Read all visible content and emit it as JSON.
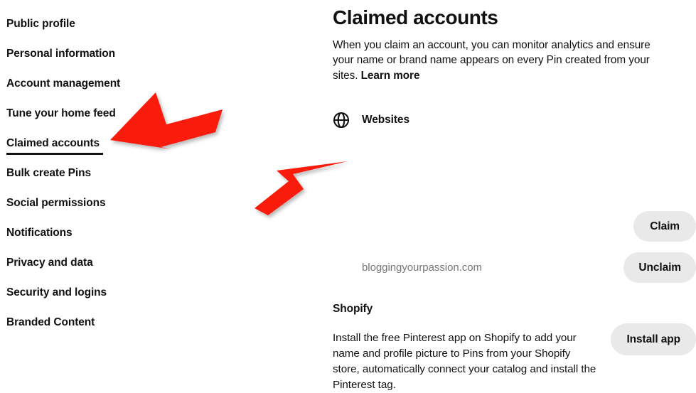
{
  "sidebar": {
    "items": [
      {
        "label": "Public profile",
        "active": false
      },
      {
        "label": "Personal information",
        "active": false
      },
      {
        "label": "Account management",
        "active": false
      },
      {
        "label": "Tune your home feed",
        "active": false
      },
      {
        "label": "Claimed accounts",
        "active": true
      },
      {
        "label": "Bulk create Pins",
        "active": false
      },
      {
        "label": "Social permissions",
        "active": false
      },
      {
        "label": "Notifications",
        "active": false
      },
      {
        "label": "Privacy and data",
        "active": false
      },
      {
        "label": "Security and logins",
        "active": false
      },
      {
        "label": "Branded Content",
        "active": false
      }
    ]
  },
  "main": {
    "title": "Claimed accounts",
    "description": "When you claim an account, you can monitor analytics and ensure your name or brand name appears on every Pin created from your sites. ",
    "learn_more_label": "Learn more",
    "websites": {
      "icon": "globe-icon",
      "label": "Websites",
      "claim_button_label": "Claim",
      "claimed_domain": "bloggingyourpassion.com",
      "unclaim_button_label": "Unclaim"
    },
    "shopify": {
      "title": "Shopify",
      "description": "Install the free Pinterest app on Shopify to add your name and profile picture to Pins from your Shopify store, automatically connect your catalog and install the Pinterest tag.",
      "install_button_label": "Install app"
    }
  },
  "annotations": {
    "arrow_color": "#f91f10",
    "arrows": [
      {
        "name": "arrow-to-claimed-accounts",
        "points_to": "Claimed accounts"
      },
      {
        "name": "arrow-to-claimed-domain",
        "points_to": "bloggingyourpassion.com"
      }
    ]
  },
  "colors": {
    "text_primary": "#111111",
    "text_muted": "#767676",
    "button_background": "#e9e9e9",
    "page_background": "#ffffff"
  }
}
